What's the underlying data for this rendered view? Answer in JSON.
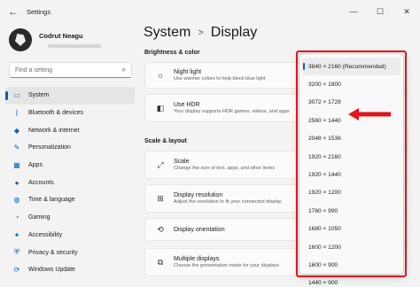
{
  "window": {
    "title": "Settings",
    "back_glyph": "←",
    "minimize_glyph": "—",
    "maximize_glyph": "☐",
    "close_glyph": "✕"
  },
  "user": {
    "name": "Codrut Neagu"
  },
  "search": {
    "placeholder": "Find a setting",
    "icon": "search-icon",
    "glyph": "⌕"
  },
  "sidebar": {
    "items": [
      {
        "label": "System",
        "icon": "monitor-icon",
        "glyph": "▭",
        "active": true
      },
      {
        "label": "Bluetooth & devices",
        "icon": "bluetooth-icon",
        "glyph": "ᛒ"
      },
      {
        "label": "Network & internet",
        "icon": "wifi-icon",
        "glyph": "◆"
      },
      {
        "label": "Personalization",
        "icon": "brush-icon",
        "glyph": "✎"
      },
      {
        "label": "Apps",
        "icon": "apps-icon",
        "glyph": "▦"
      },
      {
        "label": "Accounts",
        "icon": "person-icon",
        "glyph": "●"
      },
      {
        "label": "Time & language",
        "icon": "globe-icon",
        "glyph": "◍"
      },
      {
        "label": "Gaming",
        "icon": "gamepad-icon",
        "glyph": "◔"
      },
      {
        "label": "Accessibility",
        "icon": "accessibility-icon",
        "glyph": "✦"
      },
      {
        "label": "Privacy & security",
        "icon": "shield-icon",
        "glyph": "⛨"
      },
      {
        "label": "Windows Update",
        "icon": "update-icon",
        "glyph": "⟳"
      }
    ]
  },
  "breadcrumb": {
    "parent": "System",
    "separator": ">",
    "current": "Display"
  },
  "sections": {
    "brightness": "Brightness & color",
    "scale_layout": "Scale & layout"
  },
  "cards": {
    "night_light": {
      "title": "Night light",
      "desc": "Use warmer colors to help block blue light",
      "icon": "sun-icon",
      "glyph": "☼"
    },
    "hdr": {
      "title": "Use HDR",
      "desc": "Your display supports HDR games, videos, and apps",
      "icon": "hdr-icon",
      "glyph": "◧"
    },
    "scale": {
      "title": "Scale",
      "desc": "Change the size of text, apps, and other items",
      "icon": "scale-icon",
      "glyph": "⤢"
    },
    "resolution": {
      "title": "Display resolution",
      "desc": "Adjust the resolution to fit your connected display",
      "icon": "resolution-icon",
      "glyph": "⊞"
    },
    "orientation": {
      "title": "Display orientation",
      "desc": "",
      "icon": "orientation-icon",
      "glyph": "⟲"
    },
    "multiple": {
      "title": "Multiple displays",
      "desc": "Choose the presentation mode for your displays",
      "icon": "multiple-displays-icon",
      "glyph": "⧉"
    }
  },
  "resolution_dropdown": {
    "selected_index": 0,
    "options": [
      "3840 × 2160 (Recommended)",
      "3200 × 1800",
      "3072 × 1728",
      "2560 × 1440",
      "2048 × 1536",
      "1920 × 2160",
      "1920 × 1440",
      "1920 × 1200",
      "1760 × 990",
      "1680 × 1050",
      "1600 × 1200",
      "1600 × 900",
      "1440 × 900"
    ]
  },
  "annotation": {
    "color": "#e3141b",
    "points_to_option": 3
  },
  "colors": {
    "accent": "#005fb8",
    "background": "#f3f3f3",
    "card": "#fbfbfb"
  }
}
